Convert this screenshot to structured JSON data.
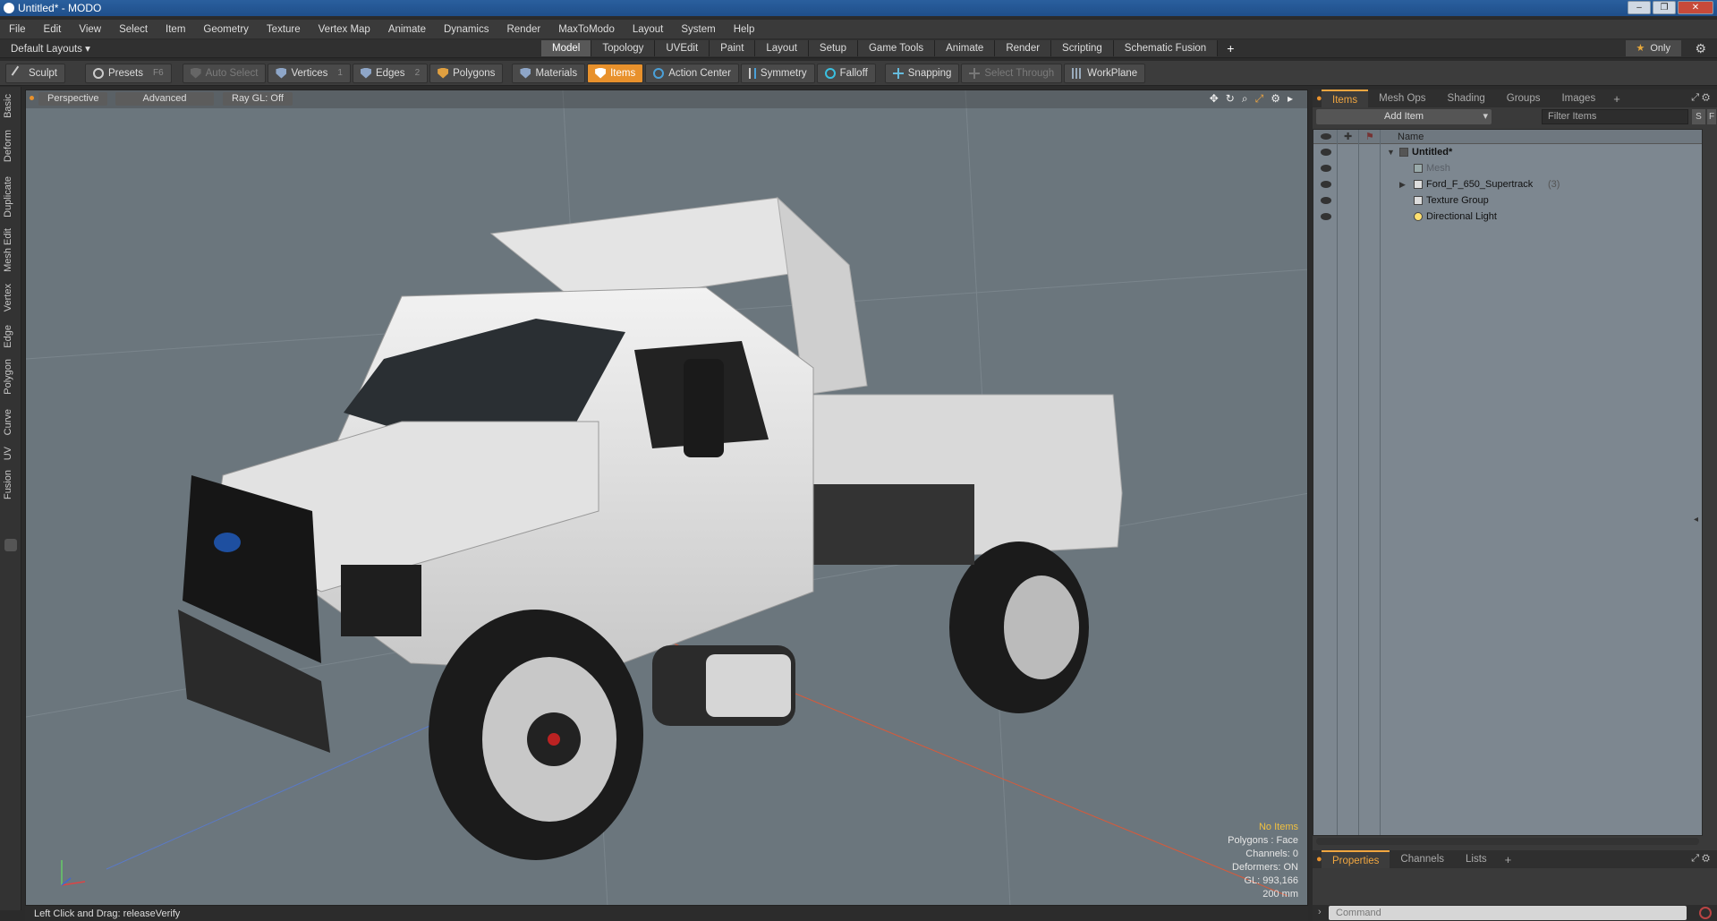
{
  "window": {
    "title": "Untitled* - MODO",
    "buttons": [
      "–",
      "❐",
      "✕"
    ]
  },
  "menu": [
    "File",
    "Edit",
    "View",
    "Select",
    "Item",
    "Geometry",
    "Texture",
    "Vertex Map",
    "Animate",
    "Dynamics",
    "Render",
    "MaxToModo",
    "Layout",
    "System",
    "Help"
  ],
  "layoutbar": {
    "layouts_label": "Default Layouts ▾",
    "tabs": [
      "Model",
      "Topology",
      "UVEdit",
      "Paint",
      "Layout",
      "Setup",
      "Game Tools",
      "Animate",
      "Render",
      "Scripting",
      "Schematic Fusion"
    ],
    "active_tab": "Model",
    "add": "+",
    "only_label": "Only"
  },
  "toolbar": {
    "sculpt": "Sculpt",
    "presets": "Presets",
    "presets_hotkey": "F6",
    "auto_select": "Auto Select",
    "vertices": "Vertices",
    "vertices_key": "1",
    "edges": "Edges",
    "edges_key": "2",
    "polygons": "Polygons",
    "materials": "Materials",
    "items": "Items",
    "action_center": "Action Center",
    "symmetry": "Symmetry",
    "falloff": "Falloff",
    "snapping": "Snapping",
    "select_through": "Select Through",
    "workplane": "WorkPlane"
  },
  "left_tabs": [
    "Basic",
    "Deform",
    "Duplicate",
    "Mesh Edit",
    "Vertex",
    "Edge",
    "Polygon",
    "Curve",
    "UV",
    "Fusion"
  ],
  "viewport": {
    "perspective": "Perspective",
    "advanced": "Advanced",
    "raygl": "Ray GL: Off",
    "info": {
      "no_items": "No Items",
      "polygons": "Polygons : Face",
      "channels": "Channels: 0",
      "deformers": "Deformers: ON",
      "gl": "GL: 993,166",
      "scale": "200 mm"
    }
  },
  "status": {
    "text": "Left Click and Drag:   releaseVerify"
  },
  "items_panel": {
    "tabs": [
      "Items",
      "Mesh Ops",
      "Shading",
      "Groups",
      "Images"
    ],
    "active_tab": "Items",
    "add": "+",
    "add_item": "Add Item",
    "filter_placeholder": "Filter Items",
    "s_btn": "S",
    "f_btn": "F",
    "name_header": "Name",
    "tree": [
      {
        "label": "Untitled*",
        "count": "",
        "level": 0
      },
      {
        "label": "Mesh",
        "count": "",
        "level": 1
      },
      {
        "label": "Ford_F_650_Supertrack",
        "count": "(3)",
        "level": 1
      },
      {
        "label": "Texture Group",
        "count": "",
        "level": 1
      },
      {
        "label": "Directional Light",
        "count": "",
        "level": 1
      }
    ]
  },
  "properties_panel": {
    "tabs": [
      "Properties",
      "Channels",
      "Lists"
    ],
    "active_tab": "Properties",
    "add": "+",
    "command_placeholder": "Command"
  },
  "colors": {
    "accent": "#f0a640",
    "viewport_bg": "#6b767d",
    "items_active": "#e8912c",
    "truck_body": "#dcdcdc"
  }
}
